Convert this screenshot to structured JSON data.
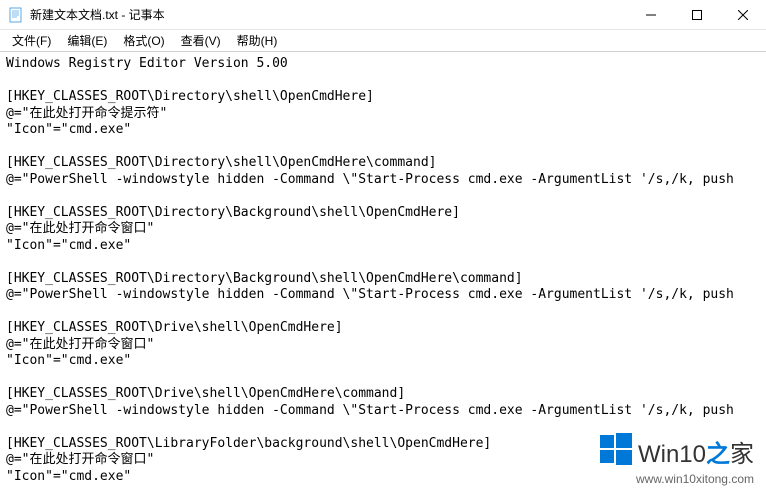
{
  "window": {
    "title": "新建文本文档.txt - 记事本"
  },
  "menu": {
    "file": "文件(F)",
    "edit": "编辑(E)",
    "format": "格式(O)",
    "view": "查看(V)",
    "help": "帮助(H)"
  },
  "content": {
    "text": "Windows Registry Editor Version 5.00\n\n[HKEY_CLASSES_ROOT\\Directory\\shell\\OpenCmdHere]\n@=\"在此处打开命令提示符\"\n\"Icon\"=\"cmd.exe\"\n\n[HKEY_CLASSES_ROOT\\Directory\\shell\\OpenCmdHere\\command]\n@=\"PowerShell -windowstyle hidden -Command \\\"Start-Process cmd.exe -ArgumentList '/s,/k, push\n\n[HKEY_CLASSES_ROOT\\Directory\\Background\\shell\\OpenCmdHere]\n@=\"在此处打开命令窗口\"\n\"Icon\"=\"cmd.exe\"\n\n[HKEY_CLASSES_ROOT\\Directory\\Background\\shell\\OpenCmdHere\\command]\n@=\"PowerShell -windowstyle hidden -Command \\\"Start-Process cmd.exe -ArgumentList '/s,/k, push\n\n[HKEY_CLASSES_ROOT\\Drive\\shell\\OpenCmdHere]\n@=\"在此处打开命令窗口\"\n\"Icon\"=\"cmd.exe\"\n\n[HKEY_CLASSES_ROOT\\Drive\\shell\\OpenCmdHere\\command]\n@=\"PowerShell -windowstyle hidden -Command \\\"Start-Process cmd.exe -ArgumentList '/s,/k, push\n\n[HKEY_CLASSES_ROOT\\LibraryFolder\\background\\shell\\OpenCmdHere]\n@=\"在此处打开命令窗口\"\n\"Icon\"=\"cmd.exe\"\n\n[HKEY_CLASSES_ROOT\\LibraryFolder\\background\\shell\\OpenCmdHere\\comm……"
  },
  "watermark": {
    "brand_prefix": "Win10",
    "brand_zhi": "之",
    "brand_suffix": "家",
    "url": "www.win10xitong.com"
  }
}
